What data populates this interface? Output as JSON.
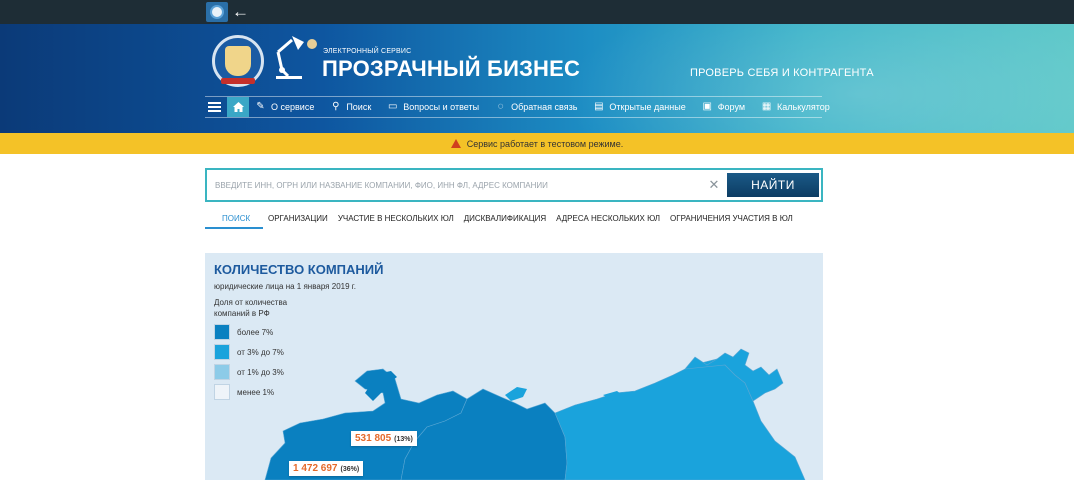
{
  "header": {
    "service_label": "ЭЛЕКТРОННЫЙ СЕРВИС",
    "brand": "ПРОЗРАЧНЫЙ БИЗНЕС",
    "slogan": "ПРОВЕРЬ СЕБЯ И КОНТРАГЕНТА"
  },
  "nav": {
    "items": [
      {
        "label": "О сервисе",
        "icon": "lamp-icon"
      },
      {
        "label": "Поиск",
        "icon": "search-icon"
      },
      {
        "label": "Вопросы и ответы",
        "icon": "chat-icon"
      },
      {
        "label": "Обратная связь",
        "icon": "feedback-icon"
      },
      {
        "label": "Открытые данные",
        "icon": "data-icon"
      },
      {
        "label": "Форум",
        "icon": "forum-icon"
      },
      {
        "label": "Калькулятор",
        "icon": "calculator-icon"
      }
    ]
  },
  "warning": {
    "text": "Сервис работает в тестовом режиме."
  },
  "search": {
    "placeholder": "Введите ИНН, ОГРН или название компании, ФИО, ИНН ФЛ, адрес компании",
    "value": "",
    "button": "НАЙТИ"
  },
  "tabs": [
    {
      "label": "ПОИСК",
      "active": true
    },
    {
      "label": "ОРГАНИЗАЦИИ",
      "active": false
    },
    {
      "label": "УЧАСТИЕ В НЕСКОЛЬКИХ ЮЛ",
      "active": false
    },
    {
      "label": "ДИСКВАЛИФИКАЦИЯ",
      "active": false
    },
    {
      "label": "АДРЕСА НЕСКОЛЬКИХ ЮЛ",
      "active": false
    },
    {
      "label": "ОГРАНИЧЕНИЯ УЧАСТИЯ В ЮЛ",
      "active": false
    }
  ],
  "map": {
    "title": "КОЛИЧЕСТВО КОМПАНИЙ",
    "subtitle": "юридические лица на 1 января 2019 г.",
    "legend_title": "Доля от количества компаний в РФ",
    "legend": [
      {
        "label": "более 7%",
        "color": "#0a80c0"
      },
      {
        "label": "от 3% до 7%",
        "color": "#1aa3dc"
      },
      {
        "label": "от 1% до 3%",
        "color": "#8ccbe8"
      },
      {
        "label": "менее 1%",
        "color": "#eef4f9"
      }
    ],
    "callouts": [
      {
        "value": "531 805",
        "pct": "(13%)"
      },
      {
        "value": "1 472 697",
        "pct": "(36%)"
      }
    ]
  },
  "colors": {
    "accent": "#3ab5c1",
    "warning_bg": "#f4c227",
    "primary_blue": "#1d5a9e"
  }
}
